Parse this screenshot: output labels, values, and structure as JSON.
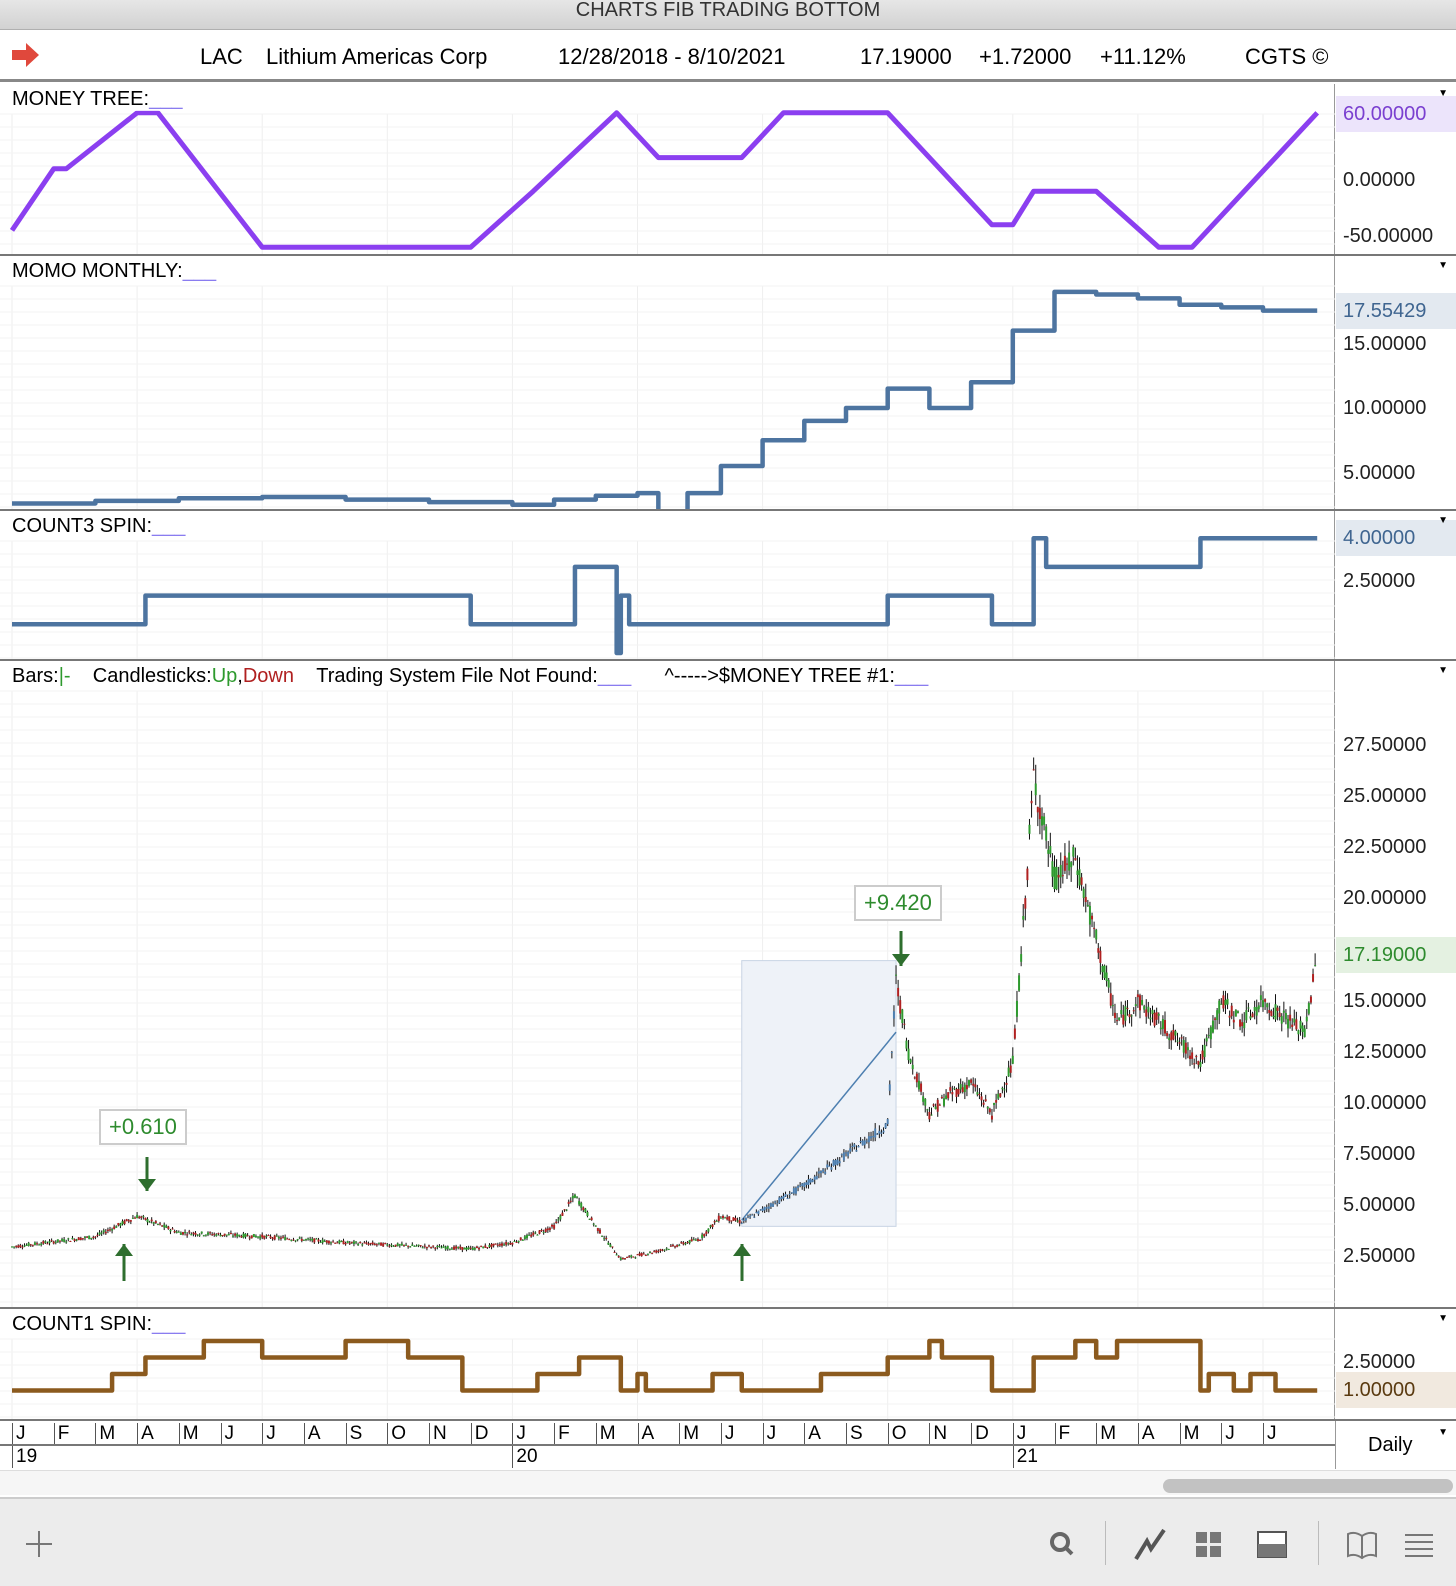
{
  "window": {
    "title": "CHARTS FIB TRADING BOTTOM"
  },
  "header": {
    "symbol": "LAC",
    "name": "Lithium Americas Corp",
    "range": "12/28/2018 - 8/10/2021",
    "last": "17.19000",
    "change": "+1.72000",
    "pct": "+11.12%",
    "brand": "CGTS ©",
    "arrow_color": "#e0483c"
  },
  "panels": {
    "money_tree": {
      "label": "MONEY TREE:",
      "blank": "___",
      "ticks": [
        "0.00000",
        "-50.00000"
      ],
      "current": "60.00000",
      "color": "#8b3ff0"
    },
    "momo": {
      "label": "MOMO MONTHLY:",
      "blank": "___",
      "ticks": [
        "15.00000",
        "10.00000",
        "5.00000"
      ],
      "current": "17.55429",
      "color": "#4d74a0"
    },
    "count3": {
      "label": "COUNT3 SPIN:",
      "blank": "___",
      "ticks": [
        "2.50000"
      ],
      "current": "4.00000",
      "color": "#4d74a0"
    },
    "main": {
      "bars": "Bars:",
      "bars_sym": "|-",
      "candles": "Candlesticks:",
      "up": "Up",
      "comma": ",",
      "down": "Down",
      "tsys": "Trading System File Not Found:",
      "blank": "___",
      "mt": "^----->$MONEY TREE #1:",
      "blank2": "___",
      "ticks": [
        "27.50000",
        "25.00000",
        "22.50000",
        "20.00000",
        "15.00000",
        "12.50000",
        "10.00000",
        "7.50000",
        "5.00000",
        "2.50000"
      ],
      "current": "17.19000",
      "annot1": "+0.610",
      "annot2": "+9.420",
      "up_color": "#2e9a2e",
      "down_color": "#b02020"
    },
    "count1": {
      "label": "COUNT1 SPIN:",
      "blank": "___",
      "ticks": [
        "2.50000"
      ],
      "current": "1.00000",
      "color": "#8b5a1e"
    }
  },
  "xaxis": {
    "months": [
      "J",
      "F",
      "M",
      "A",
      "M",
      "J",
      "J",
      "A",
      "S",
      "O",
      "N",
      "D",
      "J",
      "F",
      "M",
      "A",
      "M",
      "J",
      "J",
      "A",
      "S",
      "O",
      "N",
      "D",
      "J",
      "F",
      "M",
      "A",
      "M",
      "J",
      "J"
    ],
    "years": [
      "19",
      "20",
      "21"
    ],
    "period": "Daily"
  },
  "toolbar": [
    "plus-icon",
    "search-icon",
    "draw-icon",
    "grid-icon",
    "panel-icon",
    "book-icon",
    "menu-icon"
  ],
  "chart_data": [
    {
      "type": "line",
      "title": "MONEY TREE",
      "x_unit": "months since Jan 2019",
      "ylim": [
        -60,
        60
      ],
      "x": [
        0,
        1,
        1.3,
        3,
        3.5,
        6,
        11,
        12.5,
        14.5,
        15.5,
        17.5,
        18.5,
        21,
        23.5,
        24,
        24.5,
        26,
        27.5,
        28.3,
        31.3
      ],
      "values": [
        -45,
        10,
        10,
        60,
        60,
        -60,
        -60,
        -10,
        60,
        20,
        20,
        60,
        60,
        -40,
        -40,
        -10,
        -10,
        -60,
        -60,
        60
      ]
    },
    {
      "type": "line",
      "title": "MOMO MONTHLY",
      "step": true,
      "ylim": [
        1.5,
        20
      ],
      "x": [
        0,
        2,
        4,
        6,
        8,
        10,
        12,
        13,
        14,
        15,
        15.5,
        16.2,
        17,
        18,
        19,
        20,
        21,
        22,
        23,
        24,
        25,
        26,
        27,
        28,
        29,
        30,
        31.3
      ],
      "values": [
        2.6,
        2.8,
        3.0,
        3.1,
        2.9,
        2.7,
        2.5,
        2.9,
        3.2,
        3.4,
        2.0,
        3.4,
        5.5,
        7.5,
        9.0,
        10.0,
        11.5,
        10.0,
        12.0,
        16.0,
        19.0,
        18.8,
        18.5,
        18.0,
        17.8,
        17.55,
        17.55
      ]
    },
    {
      "type": "line",
      "title": "COUNT3 SPIN",
      "step": true,
      "ylim": [
        0,
        4.3
      ],
      "x": [
        0,
        3.2,
        11,
        13.5,
        14.5,
        14.6,
        14.8,
        15,
        21,
        23.5,
        24.5,
        24.8,
        28.5,
        31.3
      ],
      "values": [
        1,
        2,
        1,
        3,
        0,
        2,
        1,
        1,
        2,
        1,
        4,
        3,
        4,
        4
      ]
    },
    {
      "type": "candlestick",
      "title": "LAC Daily",
      "ylim": [
        0,
        30
      ],
      "keypoints_x": [
        0,
        2,
        3,
        4,
        6,
        8,
        10,
        11,
        12,
        13,
        13.5,
        14,
        14.6,
        15.5,
        16.5,
        17,
        17.5,
        19,
        20,
        21,
        21.2,
        21.5,
        22,
        22.5,
        23,
        23.5,
        24,
        24.3,
        24.5,
        25,
        25.5,
        26,
        26.5,
        27,
        28,
        28.5,
        29,
        29.5,
        30,
        31,
        31.3
      ],
      "keypoints_close": [
        3,
        3.5,
        4.5,
        3.7,
        3.5,
        3.2,
        3,
        2.9,
        3.2,
        4,
        5.5,
        4,
        2.4,
        2.8,
        3.4,
        4.5,
        4.2,
        6,
        7.5,
        9,
        16,
        12.5,
        9.5,
        10.5,
        11,
        9.5,
        12,
        20,
        26,
        21,
        22,
        18,
        14,
        15,
        13,
        12,
        15,
        14,
        15,
        13.5,
        17.19
      ]
    },
    {
      "type": "line",
      "title": "COUNT1 SPIN",
      "step": true,
      "ylim": [
        0,
        4.5
      ],
      "x": [
        0,
        2.4,
        3.2,
        4.6,
        6,
        8,
        9.5,
        10.8,
        12.6,
        13.6,
        14.6,
        15,
        15.2,
        16.8,
        17.5,
        19.4,
        21,
        22,
        22.3,
        23.5,
        24.5,
        25.5,
        26,
        26.5,
        28.5,
        28.7,
        29.3,
        29.7,
        30.3,
        31.3
      ],
      "values": [
        1,
        2,
        3,
        4,
        3,
        4,
        3,
        1,
        2,
        3,
        1,
        2,
        1,
        2,
        1,
        2,
        3,
        4,
        3,
        1,
        3,
        4,
        3,
        4,
        1,
        2,
        1,
        2,
        1,
        1
      ]
    }
  ]
}
